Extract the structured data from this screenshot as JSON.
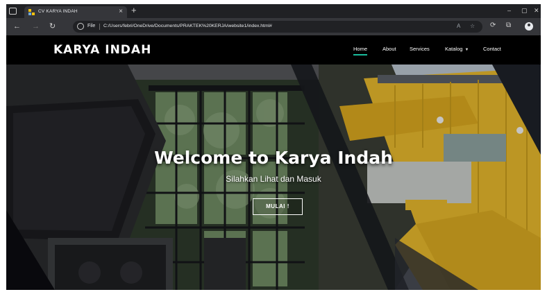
{
  "browser": {
    "tab": {
      "title": "CV KARYA INDAH",
      "close": "×"
    },
    "new_tab": "+",
    "window_controls": {
      "minimize": "–",
      "maximize": "▢",
      "close": "✕"
    },
    "nav": {
      "back": "←",
      "forward": "→",
      "reload": "↻"
    },
    "address": {
      "scheme_label": "File",
      "url": "C:/Users/febri/OneDrive/Documents/PRAKTEK%20KERJA/website1/index.html#"
    },
    "icons": [
      "tab-actions-icon",
      "read-aloud-icon",
      "favorites-icon",
      "collections-icon",
      "profile-icon",
      "more-icon"
    ]
  },
  "site": {
    "brand": "KARYA INDAH",
    "nav": [
      {
        "label": "Home",
        "active": true
      },
      {
        "label": "About",
        "active": false
      },
      {
        "label": "Services",
        "active": false
      },
      {
        "label": "Katalog",
        "active": false,
        "dropdown": true
      },
      {
        "label": "Contact",
        "active": false
      }
    ],
    "hero": {
      "title": "Welcome to Karya Indah",
      "subtitle": "Silahkan Lihat dan Masuk",
      "button": "MULAI !"
    },
    "colors": {
      "navbar": "#000000",
      "accent": "#1abc9c",
      "container": "#e6b82c",
      "sky": "#b9c4cf"
    }
  }
}
